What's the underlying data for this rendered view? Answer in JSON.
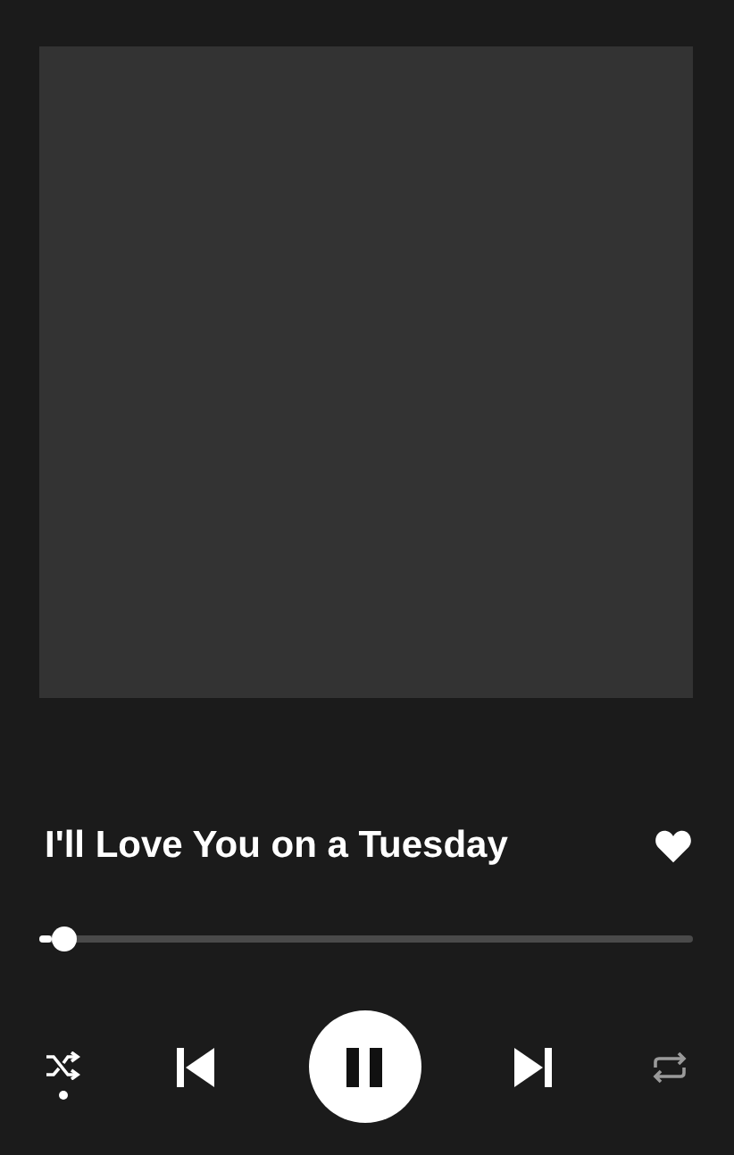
{
  "track": {
    "title": "I'll Love You on a Tuesday",
    "liked": true
  },
  "progress": {
    "level": 0.02
  },
  "controls": {
    "shuffle": true,
    "playing": true,
    "repeat": false
  }
}
